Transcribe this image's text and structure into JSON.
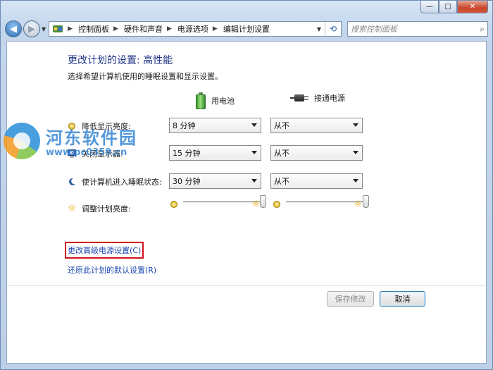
{
  "window": {
    "minimize_glyph": "—",
    "maximize_glyph": "□",
    "close_glyph": "✕"
  },
  "nav": {
    "back_glyph": "◀",
    "forward_glyph": "▶",
    "breadcrumbs": [
      "控制面板",
      "硬件和声音",
      "电源选项",
      "编辑计划设置"
    ],
    "search_placeholder": "搜索控制面板"
  },
  "page": {
    "title": "更改计划的设置: 高性能",
    "subtitle": "选择希望计算机使用的睡眠设置和显示设置。",
    "col_battery": "用电池",
    "col_plugged": "接通电源"
  },
  "settings": [
    {
      "label": "降低显示亮度:",
      "battery": "8 分钟",
      "plugged": "从不",
      "icon": "dim-display-icon"
    },
    {
      "label": "关闭显示器:",
      "battery": "15 分钟",
      "plugged": "从不",
      "icon": "monitor-icon"
    },
    {
      "label": "使计算机进入睡眠状态:",
      "battery": "30 分钟",
      "plugged": "从不",
      "icon": "sleep-moon-icon"
    }
  ],
  "brightness": {
    "label": "调整计划亮度:",
    "battery_level": 1.0,
    "plugged_level": 1.0
  },
  "links": {
    "advanced": "更改高级电源设置(C)",
    "restore": "还原此计划的默认设置(R)"
  },
  "buttons": {
    "save": "保存修改",
    "cancel": "取消"
  },
  "watermark": {
    "name": "河东软件园",
    "url": "www.pc0359.cn"
  }
}
